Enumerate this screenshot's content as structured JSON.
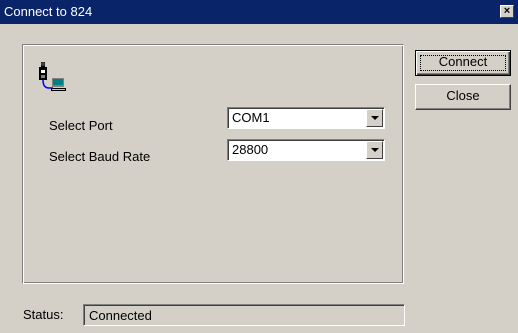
{
  "window": {
    "title": "Connect to 824",
    "close_glyph": "×"
  },
  "form": {
    "port_label": "Select Port",
    "port_value": "COM1",
    "baud_label": "Select Baud Rate",
    "baud_value": "28800"
  },
  "buttons": {
    "connect": "Connect",
    "close": "Close"
  },
  "status": {
    "label": "Status:",
    "value": "Connected"
  },
  "icons": {
    "device": "sound-level-meter-to-computer-icon"
  },
  "colors": {
    "titlebar": "#0a246a",
    "face": "#d4d0c8"
  }
}
